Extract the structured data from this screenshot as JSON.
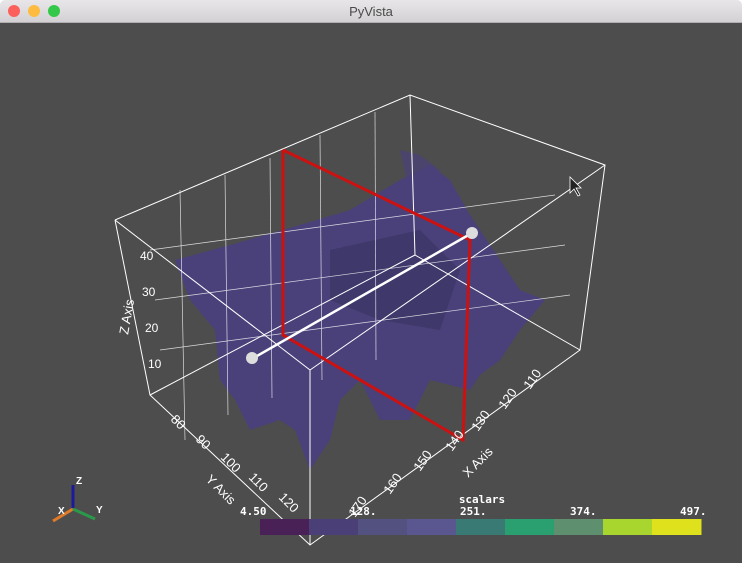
{
  "window": {
    "title": "PyVista"
  },
  "traffic_lights": {
    "close": "#fc605c",
    "minimize": "#fdbc40",
    "maximize": "#34c84a"
  },
  "axes": {
    "x_title": "X Axis",
    "y_title": "Y Axis",
    "z_title": "Z Axis",
    "x_ticks": [
      "110",
      "120",
      "130",
      "140",
      "150",
      "160",
      "170"
    ],
    "y_ticks": [
      "80",
      "90",
      "100",
      "110",
      "120"
    ],
    "z_ticks": [
      "10",
      "20",
      "30",
      "40"
    ]
  },
  "orientation_widget": {
    "x": "X",
    "y": "Y",
    "z": "Z",
    "x_color": "#e07b2a",
    "y_color": "#2a9a4a",
    "z_color": "#1a1a9a"
  },
  "scalar_bar": {
    "title": "scalars",
    "labels": [
      "4.50",
      "128.",
      "251.",
      "374.",
      "497."
    ],
    "colors": [
      "#4a2156",
      "#4b3f78",
      "#53517f",
      "#5a5790",
      "#3a7a74",
      "#2aa070",
      "#5e9070",
      "#a8d62e",
      "#dee11c"
    ]
  },
  "colors": {
    "background": "#4d4d4d",
    "volume": "#4a3f82",
    "plane_edge": "#cc1111"
  }
}
